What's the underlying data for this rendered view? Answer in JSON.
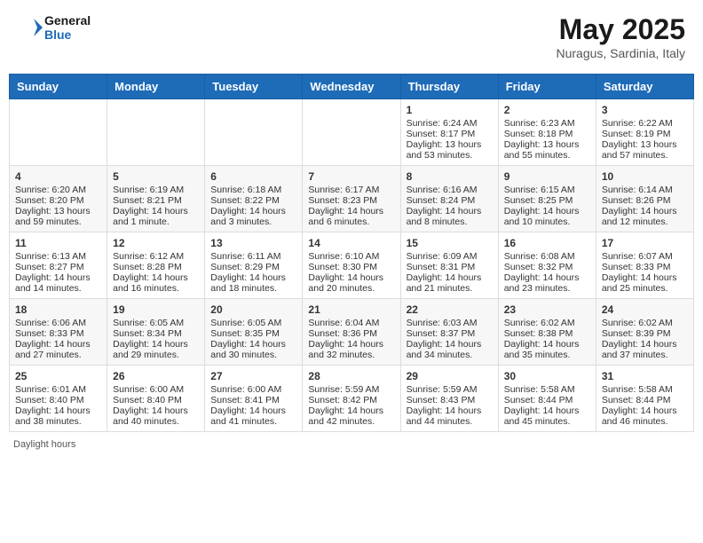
{
  "header": {
    "logo_general": "General",
    "logo_blue": "Blue",
    "month_title": "May 2025",
    "subtitle": "Nuragus, Sardinia, Italy"
  },
  "days_of_week": [
    "Sunday",
    "Monday",
    "Tuesday",
    "Wednesday",
    "Thursday",
    "Friday",
    "Saturday"
  ],
  "weeks": [
    [
      {
        "day": "",
        "empty": true
      },
      {
        "day": "",
        "empty": true
      },
      {
        "day": "",
        "empty": true
      },
      {
        "day": "",
        "empty": true
      },
      {
        "day": "1",
        "sunrise": "6:24 AM",
        "sunset": "8:17 PM",
        "daylight": "13 hours and 53 minutes."
      },
      {
        "day": "2",
        "sunrise": "6:23 AM",
        "sunset": "8:18 PM",
        "daylight": "13 hours and 55 minutes."
      },
      {
        "day": "3",
        "sunrise": "6:22 AM",
        "sunset": "8:19 PM",
        "daylight": "13 hours and 57 minutes."
      }
    ],
    [
      {
        "day": "4",
        "sunrise": "6:20 AM",
        "sunset": "8:20 PM",
        "daylight": "13 hours and 59 minutes."
      },
      {
        "day": "5",
        "sunrise": "6:19 AM",
        "sunset": "8:21 PM",
        "daylight": "14 hours and 1 minute."
      },
      {
        "day": "6",
        "sunrise": "6:18 AM",
        "sunset": "8:22 PM",
        "daylight": "14 hours and 3 minutes."
      },
      {
        "day": "7",
        "sunrise": "6:17 AM",
        "sunset": "8:23 PM",
        "daylight": "14 hours and 6 minutes."
      },
      {
        "day": "8",
        "sunrise": "6:16 AM",
        "sunset": "8:24 PM",
        "daylight": "14 hours and 8 minutes."
      },
      {
        "day": "9",
        "sunrise": "6:15 AM",
        "sunset": "8:25 PM",
        "daylight": "14 hours and 10 minutes."
      },
      {
        "day": "10",
        "sunrise": "6:14 AM",
        "sunset": "8:26 PM",
        "daylight": "14 hours and 12 minutes."
      }
    ],
    [
      {
        "day": "11",
        "sunrise": "6:13 AM",
        "sunset": "8:27 PM",
        "daylight": "14 hours and 14 minutes."
      },
      {
        "day": "12",
        "sunrise": "6:12 AM",
        "sunset": "8:28 PM",
        "daylight": "14 hours and 16 minutes."
      },
      {
        "day": "13",
        "sunrise": "6:11 AM",
        "sunset": "8:29 PM",
        "daylight": "14 hours and 18 minutes."
      },
      {
        "day": "14",
        "sunrise": "6:10 AM",
        "sunset": "8:30 PM",
        "daylight": "14 hours and 20 minutes."
      },
      {
        "day": "15",
        "sunrise": "6:09 AM",
        "sunset": "8:31 PM",
        "daylight": "14 hours and 21 minutes."
      },
      {
        "day": "16",
        "sunrise": "6:08 AM",
        "sunset": "8:32 PM",
        "daylight": "14 hours and 23 minutes."
      },
      {
        "day": "17",
        "sunrise": "6:07 AM",
        "sunset": "8:33 PM",
        "daylight": "14 hours and 25 minutes."
      }
    ],
    [
      {
        "day": "18",
        "sunrise": "6:06 AM",
        "sunset": "8:33 PM",
        "daylight": "14 hours and 27 minutes."
      },
      {
        "day": "19",
        "sunrise": "6:05 AM",
        "sunset": "8:34 PM",
        "daylight": "14 hours and 29 minutes."
      },
      {
        "day": "20",
        "sunrise": "6:05 AM",
        "sunset": "8:35 PM",
        "daylight": "14 hours and 30 minutes."
      },
      {
        "day": "21",
        "sunrise": "6:04 AM",
        "sunset": "8:36 PM",
        "daylight": "14 hours and 32 minutes."
      },
      {
        "day": "22",
        "sunrise": "6:03 AM",
        "sunset": "8:37 PM",
        "daylight": "14 hours and 34 minutes."
      },
      {
        "day": "23",
        "sunrise": "6:02 AM",
        "sunset": "8:38 PM",
        "daylight": "14 hours and 35 minutes."
      },
      {
        "day": "24",
        "sunrise": "6:02 AM",
        "sunset": "8:39 PM",
        "daylight": "14 hours and 37 minutes."
      }
    ],
    [
      {
        "day": "25",
        "sunrise": "6:01 AM",
        "sunset": "8:40 PM",
        "daylight": "14 hours and 38 minutes."
      },
      {
        "day": "26",
        "sunrise": "6:00 AM",
        "sunset": "8:40 PM",
        "daylight": "14 hours and 40 minutes."
      },
      {
        "day": "27",
        "sunrise": "6:00 AM",
        "sunset": "8:41 PM",
        "daylight": "14 hours and 41 minutes."
      },
      {
        "day": "28",
        "sunrise": "5:59 AM",
        "sunset": "8:42 PM",
        "daylight": "14 hours and 42 minutes."
      },
      {
        "day": "29",
        "sunrise": "5:59 AM",
        "sunset": "8:43 PM",
        "daylight": "14 hours and 44 minutes."
      },
      {
        "day": "30",
        "sunrise": "5:58 AM",
        "sunset": "8:44 PM",
        "daylight": "14 hours and 45 minutes."
      },
      {
        "day": "31",
        "sunrise": "5:58 AM",
        "sunset": "8:44 PM",
        "daylight": "14 hours and 46 minutes."
      }
    ]
  ],
  "footer": {
    "label": "Daylight hours"
  }
}
